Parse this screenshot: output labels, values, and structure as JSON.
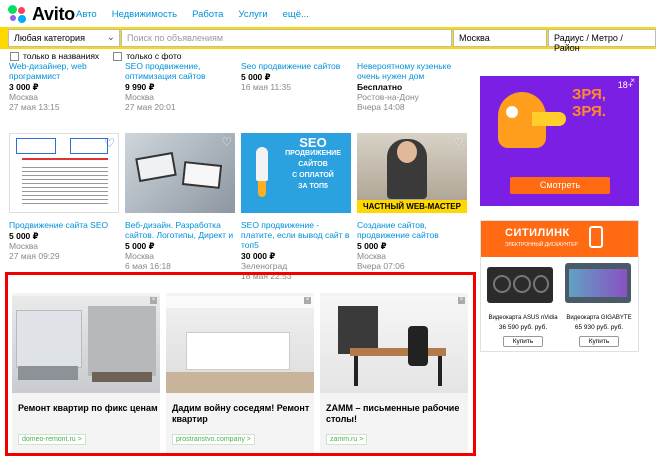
{
  "header": {
    "logo": "Avito",
    "nav": [
      "Авто",
      "Недвижимость",
      "Работа",
      "Услуги",
      "ещё..."
    ]
  },
  "search": {
    "category": "Любая категория",
    "placeholder": "Поиск по объявлениям",
    "city": "Москва",
    "radius": "Радиус / Метро / Район",
    "only_titles": "только в названиях",
    "with_photo": "только с фото"
  },
  "listings_row1": [
    {
      "title": "Web-дизайнер, web программист",
      "price": "3 000 ₽",
      "loc": "Москва",
      "date": "27 мая 13:15"
    },
    {
      "title": "SEO продвижение, оптимизация сайтов",
      "price": "9 990 ₽",
      "loc": "Москва",
      "date": "27 мая 20:01"
    },
    {
      "title": "Seo продвижение сайтов",
      "price": "5 000 ₽",
      "loc": "",
      "date": "16 мая 11:35"
    },
    {
      "title": "Невероятному кузеньке очень нужен дом",
      "price": "Бесплатно",
      "loc": "Ростов-на-Дону",
      "date": "Вчера 14:08"
    }
  ],
  "listings_row2": [
    {
      "title": "Продвижение сайта SEO",
      "price": "5 000 ₽",
      "loc": "Москва",
      "date": "27 мая 09:29"
    },
    {
      "title": "Веб-дизайн. Разработка сайтов. Логотипы, Директ и",
      "price": "5 000 ₽",
      "loc": "Москва",
      "date": "6 мая 16:18"
    },
    {
      "title": "SEO продвижение - платите, если вывод сайт в топ5",
      "price": "30 000 ₽",
      "loc": "Зеленоград",
      "date": "18 мая 22:53"
    },
    {
      "title": "Создание сайтов, продвижение сайтов",
      "price": "5 000 ₽",
      "loc": "Москва",
      "date": "Вчера 07:06"
    }
  ],
  "thumbs": {
    "seo_banner_lines": [
      "SEO",
      "ПРОДВИЖЕНИЕ",
      "САЙТОВ",
      "С ОПЛАТОЙ",
      "ЗА ТОП5"
    ],
    "master_caption": "ЧАСТНЫЙ WEB-МАСТЕР"
  },
  "banner1": {
    "badge": "18+",
    "text": "ЗРЯ, ЗРЯ.",
    "button": "Смотреть"
  },
  "banner2": {
    "brand": "СИТИЛИНК",
    "tagline": "ЭЛЕКТРОННЫЙ ДИСКАУНТЕР",
    "products": [
      {
        "name": "Видеокарта ASUS nVidia",
        "price": "36 590 руб. руб.",
        "button": "Купить"
      },
      {
        "name": "Видеокарта GIGABYTE",
        "price": "65 930 руб. руб.",
        "button": "Купить"
      }
    ]
  },
  "ads": [
    {
      "title": "Ремонт квартир по фикс ценам",
      "domain": "domeo-remont.ru >"
    },
    {
      "title": "Дадим войну соседям! Ремонт квартир",
      "domain": "prostranstvo.company >"
    },
    {
      "title": "ZAMM – письменные рабочие столы!",
      "domain": "zamm.ru >"
    }
  ],
  "colors": {
    "brand_blue": "#0091d9",
    "search_yellow": "#ffd800",
    "highlight_red": "#f20000",
    "banner_purple": "#7c1fe4",
    "button_orange": "#ff6a13"
  }
}
